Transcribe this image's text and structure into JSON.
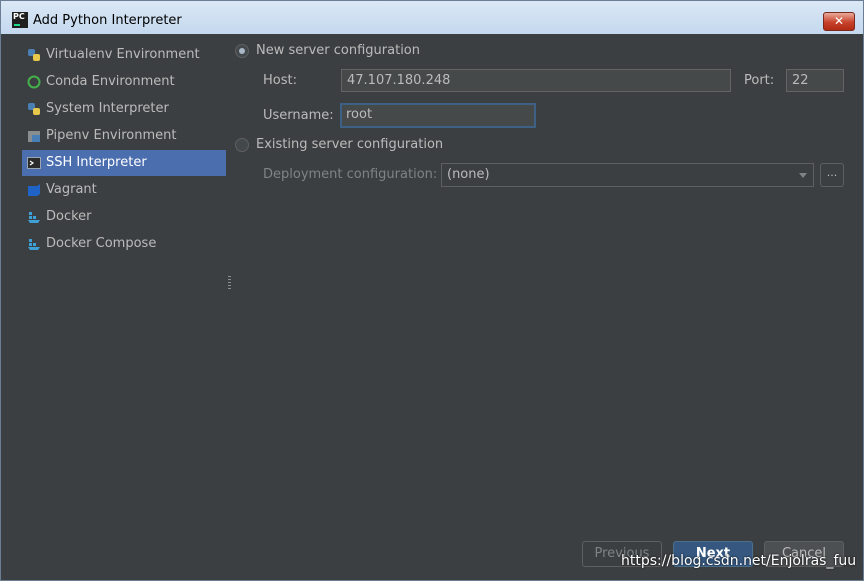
{
  "window": {
    "title": "Add Python Interpreter",
    "app_icon_text": "PC"
  },
  "sidebar": {
    "items": [
      {
        "label": "Virtualenv Environment",
        "icon": "python-icon"
      },
      {
        "label": "Conda Environment",
        "icon": "conda-icon"
      },
      {
        "label": "System Interpreter",
        "icon": "python-icon"
      },
      {
        "label": "Pipenv Environment",
        "icon": "pipenv-icon"
      },
      {
        "label": "SSH Interpreter",
        "icon": "terminal-icon",
        "selected": true
      },
      {
        "label": "Vagrant",
        "icon": "vagrant-icon"
      },
      {
        "label": "Docker",
        "icon": "docker-icon"
      },
      {
        "label": "Docker Compose",
        "icon": "docker-icon"
      }
    ]
  },
  "form": {
    "new_server_label": "New server configuration",
    "host_label": "Host:",
    "host_value": "47.107.180.248",
    "port_label": "Port:",
    "port_value": "22",
    "username_label": "Username:",
    "username_value": "root",
    "existing_server_label": "Existing server configuration",
    "deployment_label": "Deployment configuration:",
    "deployment_value": "(none)",
    "browse_label": "..."
  },
  "buttons": {
    "previous": "Previous",
    "next": "Next",
    "cancel": "Cancel"
  },
  "watermark": "https://blog.csdn.net/Enjolras_fuu",
  "colors": {
    "background": "#3c3f41",
    "selection": "#4b6eaf",
    "primary": "#365880"
  }
}
